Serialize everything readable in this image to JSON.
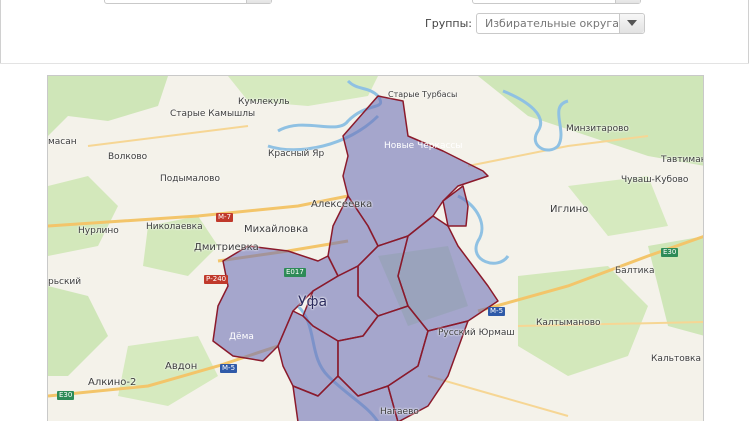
{
  "filters": {
    "groups_label": "Группы:",
    "groups_value": "Избирательные округа"
  },
  "map": {
    "labels": {
      "starye_turbasly": "Старые Турбасы",
      "kumlekul": "Кумлекуль",
      "starye_kamyshly": "Старые Камышлы",
      "minzitarovo": "Минзитарово",
      "amasan": "масан",
      "volkovo": "Волково",
      "krasny_yar": "Красный Яр",
      "novye_cherkassy": "Новые Черкассы",
      "tavtiman": "Тавтиман",
      "podymalovo": "Подымалово",
      "chuvash_kubovo": "Чуваш-Кубово",
      "alekseevka": "Алексеевка",
      "iglino": "Иглино",
      "nurlino": "Нурлино",
      "nikolaevka": "Николаевка",
      "mikhailovka": "Михайловка",
      "dmitrievka": "Дмитриевка",
      "baltika": "Балтика",
      "rsky": "рьский",
      "ufa": "Уфа",
      "russky_yurmash": "Русский Юрмаш",
      "kaltymanovo": "Калтыманово",
      "dema": "Дёма",
      "kaltovka": "Кальтовка",
      "avdon": "Авдон",
      "alkino": "Алкино-2",
      "nagaevo": "Нагаево"
    },
    "roads": {
      "m7": "М-7",
      "r240": "Р-240",
      "e017": "E017",
      "m5a": "М-5",
      "m5b": "М-5",
      "e30a": "E30",
      "e30b": "E30"
    },
    "colors": {
      "district_fill": "#6f73b8",
      "district_border": "#8b1a2b",
      "river": "#8fc1e3",
      "forest": "#cfe6b8"
    }
  }
}
